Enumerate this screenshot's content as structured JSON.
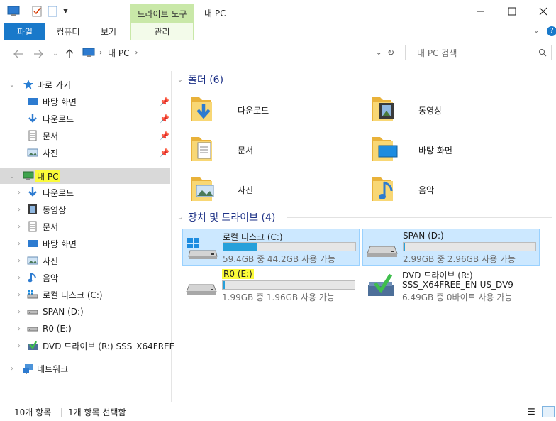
{
  "window": {
    "context_tab_header": "드라이브 도구",
    "title": "내 PC"
  },
  "ribbon": {
    "tabs": [
      "파일",
      "컴퓨터",
      "보기",
      "관리"
    ]
  },
  "address": {
    "path": [
      "내 PC"
    ],
    "search_placeholder": "내 PC 검색"
  },
  "nav": {
    "quick_access": "바로 가기",
    "quick_items": [
      "바탕 화면",
      "다운로드",
      "문서",
      "사진"
    ],
    "this_pc": "내 PC",
    "pc_items": [
      "다운로드",
      "동영상",
      "문서",
      "바탕 화면",
      "사진",
      "음악",
      "로컬 디스크 (C:)",
      "SPAN (D:)",
      "R0 (E:)",
      "DVD 드라이브 (R:) SSS_X64FREE_"
    ],
    "network": "네트워크"
  },
  "folders": {
    "title": "폴더 (6)",
    "items": [
      "다운로드",
      "동영상",
      "문서",
      "바탕 화면",
      "사진",
      "음악"
    ]
  },
  "devices": {
    "title": "장치 및 드라이브 (4)",
    "items": [
      {
        "name": "로컬 디스크 (C:)",
        "free": "59.4GB 중 44.2GB 사용 가능",
        "used_fraction": 0.26
      },
      {
        "name": "SPAN (D:)",
        "free": "2.99GB 중 2.96GB 사용 가능",
        "used_fraction": 0.01
      },
      {
        "name": "R0 (E:)",
        "free": "1.99GB 중 1.96GB 사용 가능",
        "used_fraction": 0.015
      },
      {
        "name": "DVD 드라이브 (R:)",
        "label": "SSS_X64FREE_EN-US_DV9",
        "free": "6.49GB 중 0바이트 사용 가능"
      }
    ]
  },
  "status": {
    "count": "10개 항목",
    "selected": "1개 항목 선택함"
  },
  "colors": {
    "accent": "#1979ca",
    "context_tab": "#c9e8a8",
    "highlight": "#fbfb3a",
    "folder": "#f5c548",
    "bar_fill": "#26a0da"
  }
}
